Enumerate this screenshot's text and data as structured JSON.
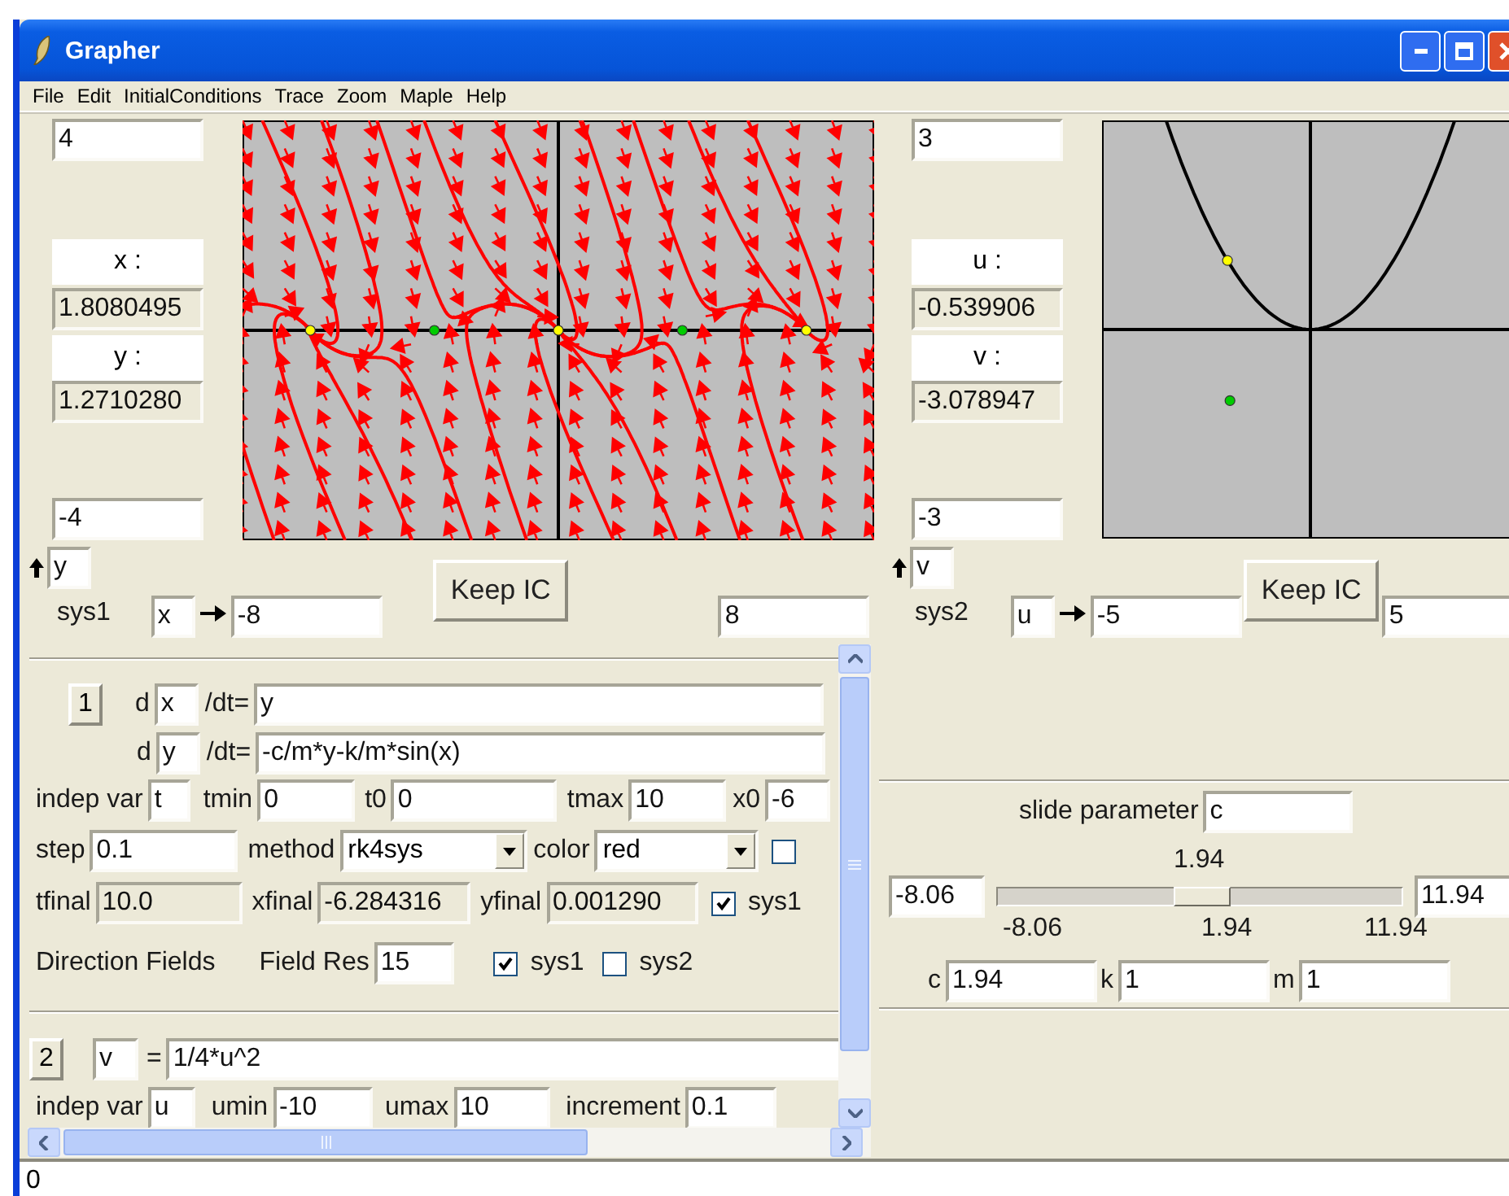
{
  "window": {
    "title": "Grapher"
  },
  "menu": [
    "File",
    "Edit",
    "InitialConditions",
    "Trace",
    "Zoom",
    "Maple",
    "Help"
  ],
  "sys1": {
    "ymax": "4",
    "x_label": "x :",
    "x_value": "1.8080495",
    "y_label": "y :",
    "y_value": "1.2710280",
    "ymin": "-4",
    "y_var": "y",
    "name": "sys1",
    "x_var": "x",
    "xmin": "-8",
    "keep_button": "Keep IC",
    "xmax": "8"
  },
  "sys2": {
    "ymax": "3",
    "x_label": "u :",
    "x_value": "-0.539906",
    "y_label": "v :",
    "y_value": "-3.078947",
    "ymin": "-3",
    "y_var": "v",
    "name": "sys2",
    "x_var": "u",
    "xmin": "-5",
    "keep_button": "Keep IC",
    "xmax": "5"
  },
  "system1_panel": {
    "number_button": "1",
    "equations": [
      {
        "d": "d",
        "var": "x",
        "suffix": "/dt=",
        "expr": "y"
      },
      {
        "d": "d",
        "var": "y",
        "suffix": "/dt=",
        "expr": "-c/m*y-k/m*sin(x)"
      }
    ],
    "time_fields": [
      {
        "label": "indep var",
        "value": "t"
      },
      {
        "label": "tmin",
        "value": "0"
      },
      {
        "label": "t0",
        "value": "0"
      },
      {
        "label": "tmax",
        "value": "10"
      },
      {
        "label": "x0",
        "value": "-6"
      }
    ],
    "step": {
      "label": "step",
      "value": "0.1"
    },
    "method": {
      "label": "method",
      "value": "rk4sys"
    },
    "color": {
      "label": "color",
      "value": "red"
    },
    "extra_checkbox": {
      "checked": false
    },
    "finals": [
      {
        "label": "tfinal",
        "value": "10.0"
      },
      {
        "label": "xfinal",
        "value": "-6.284316"
      },
      {
        "label": "yfinal",
        "value": "0.001290"
      }
    ],
    "finals_checkbox": {
      "label": "sys1",
      "checked": true
    },
    "direction_fields": {
      "label": "Direction Fields",
      "res_label": "Field Res",
      "res_value": "15",
      "checks": [
        {
          "label": "sys1",
          "checked": true
        },
        {
          "label": "sys2",
          "checked": false
        }
      ]
    }
  },
  "system2_panel": {
    "number_button": "2",
    "var": "v",
    "equals": "=",
    "expr": "1/4*u^2",
    "fields": [
      {
        "label": "indep var",
        "value": "u"
      },
      {
        "label": "umin",
        "value": "-10"
      },
      {
        "label": "umax",
        "value": "10"
      },
      {
        "label": "increment",
        "value": "0.1"
      }
    ]
  },
  "slider_panel": {
    "label": "slide parameter",
    "parameter": "c",
    "value_label": "1.94",
    "min_field": "-8.06",
    "max_field": "11.94",
    "level": 0.5,
    "ticks": [
      "-8.06",
      "1.94",
      "11.94"
    ],
    "params": [
      {
        "label": "c",
        "value": "1.94"
      },
      {
        "label": "k",
        "value": "1"
      },
      {
        "label": "m",
        "value": "1"
      }
    ]
  },
  "status_bar": "0"
}
